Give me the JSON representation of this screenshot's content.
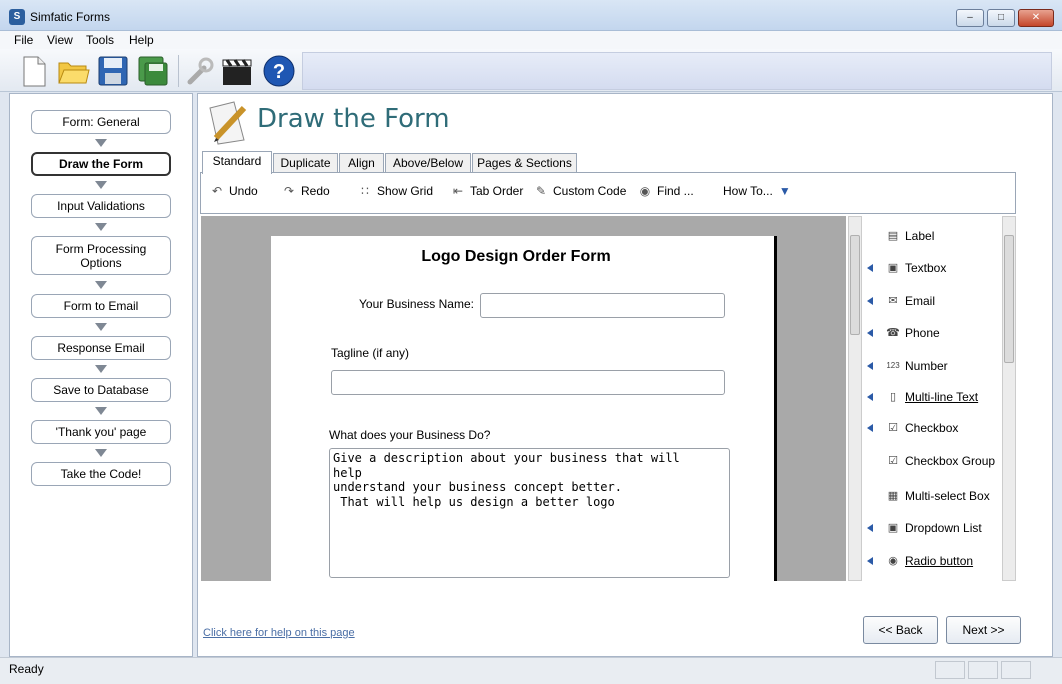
{
  "window": {
    "title": "Simfatic Forms",
    "min_label": "–",
    "max_label": "□",
    "close_label": "✕"
  },
  "menu": [
    "File",
    "View",
    "Tools",
    "Help"
  ],
  "toolbar": {
    "buttons": [
      "new-document-icon",
      "open-folder-icon",
      "save-icon",
      "save-as-icon",
      "settings-wrench-icon",
      "clapperboard-icon",
      "help-icon"
    ]
  },
  "wizard": {
    "steps": [
      {
        "label": "Form: General",
        "active": false
      },
      {
        "label": "Draw the Form",
        "active": true
      },
      {
        "label": "Input Validations",
        "active": false
      },
      {
        "label": "Form Processing Options",
        "active": false
      },
      {
        "label": "Form to Email",
        "active": false
      },
      {
        "label": "Response Email",
        "active": false
      },
      {
        "label": "Save to Database",
        "active": false
      },
      {
        "label": "'Thank you' page",
        "active": false
      },
      {
        "label": "Take the Code!",
        "active": false
      }
    ]
  },
  "main": {
    "heading": "Draw the Form",
    "tabs": [
      "Standard",
      "Duplicate",
      "Align",
      "Above/Below",
      "Pages & Sections"
    ],
    "active_tab": "Standard",
    "commands": {
      "undo": "Undo",
      "redo": "Redo",
      "show_grid": "Show Grid",
      "tab_order": "Tab Order",
      "custom_code": "Custom Code",
      "find": "Find ...",
      "how_to": "How To..."
    },
    "help_link": "Click here for help on this page",
    "back_button": "<< Back",
    "next_button": "Next >>"
  },
  "form": {
    "title": "Logo Design Order Form",
    "business_name_label": "Your Business Name:",
    "tagline_label": "Tagline (if any)",
    "business_do_label": "What does your Business Do?",
    "business_do_text": "Give a description about your business that will\nhelp\nunderstand your business concept better.\n That will help us design a better logo"
  },
  "palette": [
    {
      "label": "Label",
      "icon": "label-icon",
      "arrow": false
    },
    {
      "label": "Textbox",
      "icon": "textbox-icon",
      "arrow": true
    },
    {
      "label": "Email",
      "icon": "email-icon",
      "arrow": true
    },
    {
      "label": "Phone",
      "icon": "phone-icon",
      "arrow": true
    },
    {
      "label": "Number",
      "icon": "number-icon",
      "arrow": true
    },
    {
      "label": "Multi-line Text",
      "icon": "multiline-icon",
      "arrow": true
    },
    {
      "label": "Checkbox",
      "icon": "checkbox-icon",
      "arrow": true
    },
    {
      "label": "Checkbox Group",
      "icon": "checkbox-group-icon",
      "arrow": false
    },
    {
      "label": "Multi-select Box",
      "icon": "multiselect-icon",
      "arrow": false
    },
    {
      "label": "Dropdown List",
      "icon": "dropdown-icon",
      "arrow": true
    },
    {
      "label": "Radio button",
      "icon": "radio-icon",
      "arrow": true
    }
  ],
  "status": {
    "text": "Ready"
  },
  "colors": {
    "heading": "#2f6c78",
    "canvas_bg": "#a9a9a9",
    "link": "#4a6ea5"
  }
}
